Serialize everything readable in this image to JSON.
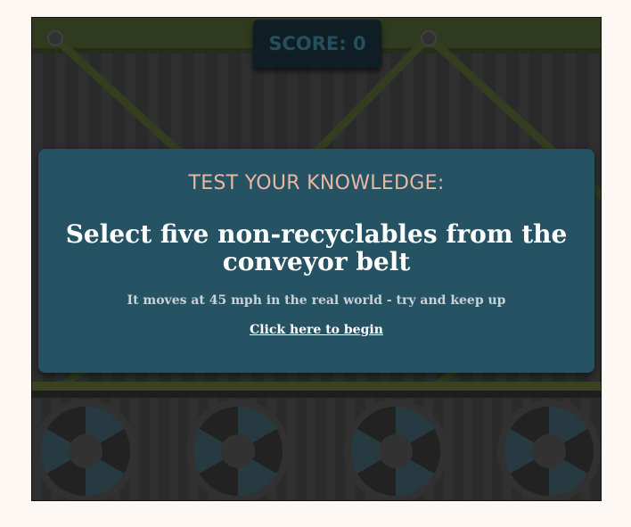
{
  "score": {
    "label": "SCORE:",
    "value": "0"
  },
  "intro": {
    "heading": "TEST YOUR KNOWLEDGE:",
    "title": "Select five non-recyclables from the conveyor belt",
    "subtitle": "It moves at 45 mph in the real world - try and keep up",
    "begin_link": "Click here to begin"
  },
  "colors": {
    "modal_bg": "#255364",
    "heading": "#e9b7a2",
    "girder": "#3a4a1f",
    "score_bg": "#0f1e24"
  }
}
